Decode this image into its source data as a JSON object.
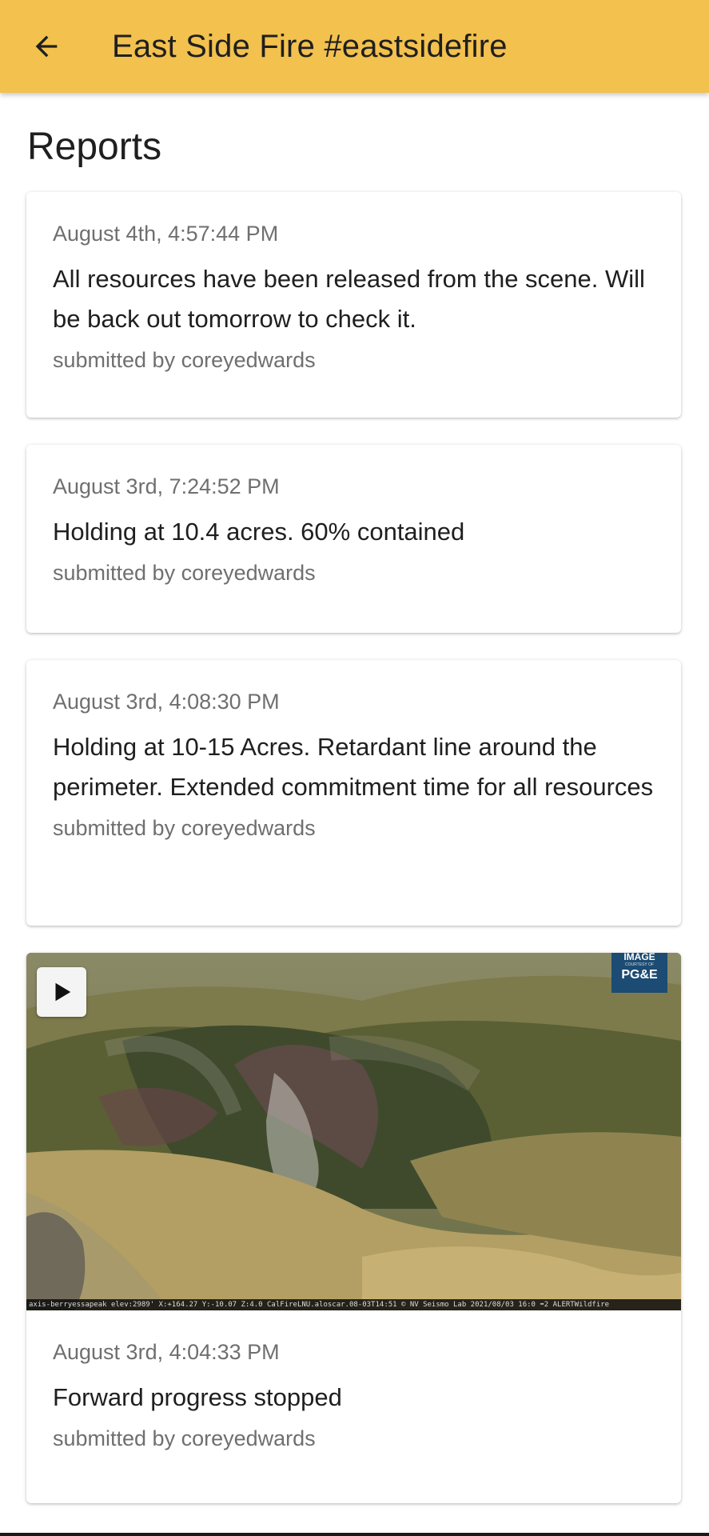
{
  "appbar": {
    "title": "East Side Fire #eastsidefire",
    "background": "#f2c14e",
    "back_icon": "arrow-left-icon"
  },
  "section_title": "Reports",
  "reports": [
    {
      "timestamp": "August 4th, 4:57:44 PM",
      "text": "All resources have been released from the scene. Will be back out tomorrow to check it.",
      "submitted_by": "submitted by coreyedwards"
    },
    {
      "timestamp": "August 3rd, 7:24:52 PM",
      "text": "Holding at 10.4 acres. 60% contained",
      "submitted_by": "submitted by coreyedwards"
    },
    {
      "timestamp": "August 3rd, 4:08:30 PM",
      "text": "Holding at 10-15 Acres. Retardant line around the perimeter. Extended commitment time for all resources",
      "submitted_by": "submitted by coreyedwards"
    },
    {
      "timestamp": "August 3rd, 4:04:33 PM",
      "text": "Forward progress stopped",
      "submitted_by": "submitted by coreyedwards",
      "media": {
        "play_icon": "play-icon",
        "badge_line1": "IMAGE",
        "badge_line2": "COURTESY OF",
        "badge_line3": "PG&E",
        "camera_caption": "axis-berryessapeak elev:2989' X:+164.27 Y:-10.07 Z:4.0 CalFireLNU.aloscar.08-03T14:51 © NV Seismo Lab 2021/08/03 16:0 ⬌2 ALERTWildfire"
      }
    }
  ]
}
